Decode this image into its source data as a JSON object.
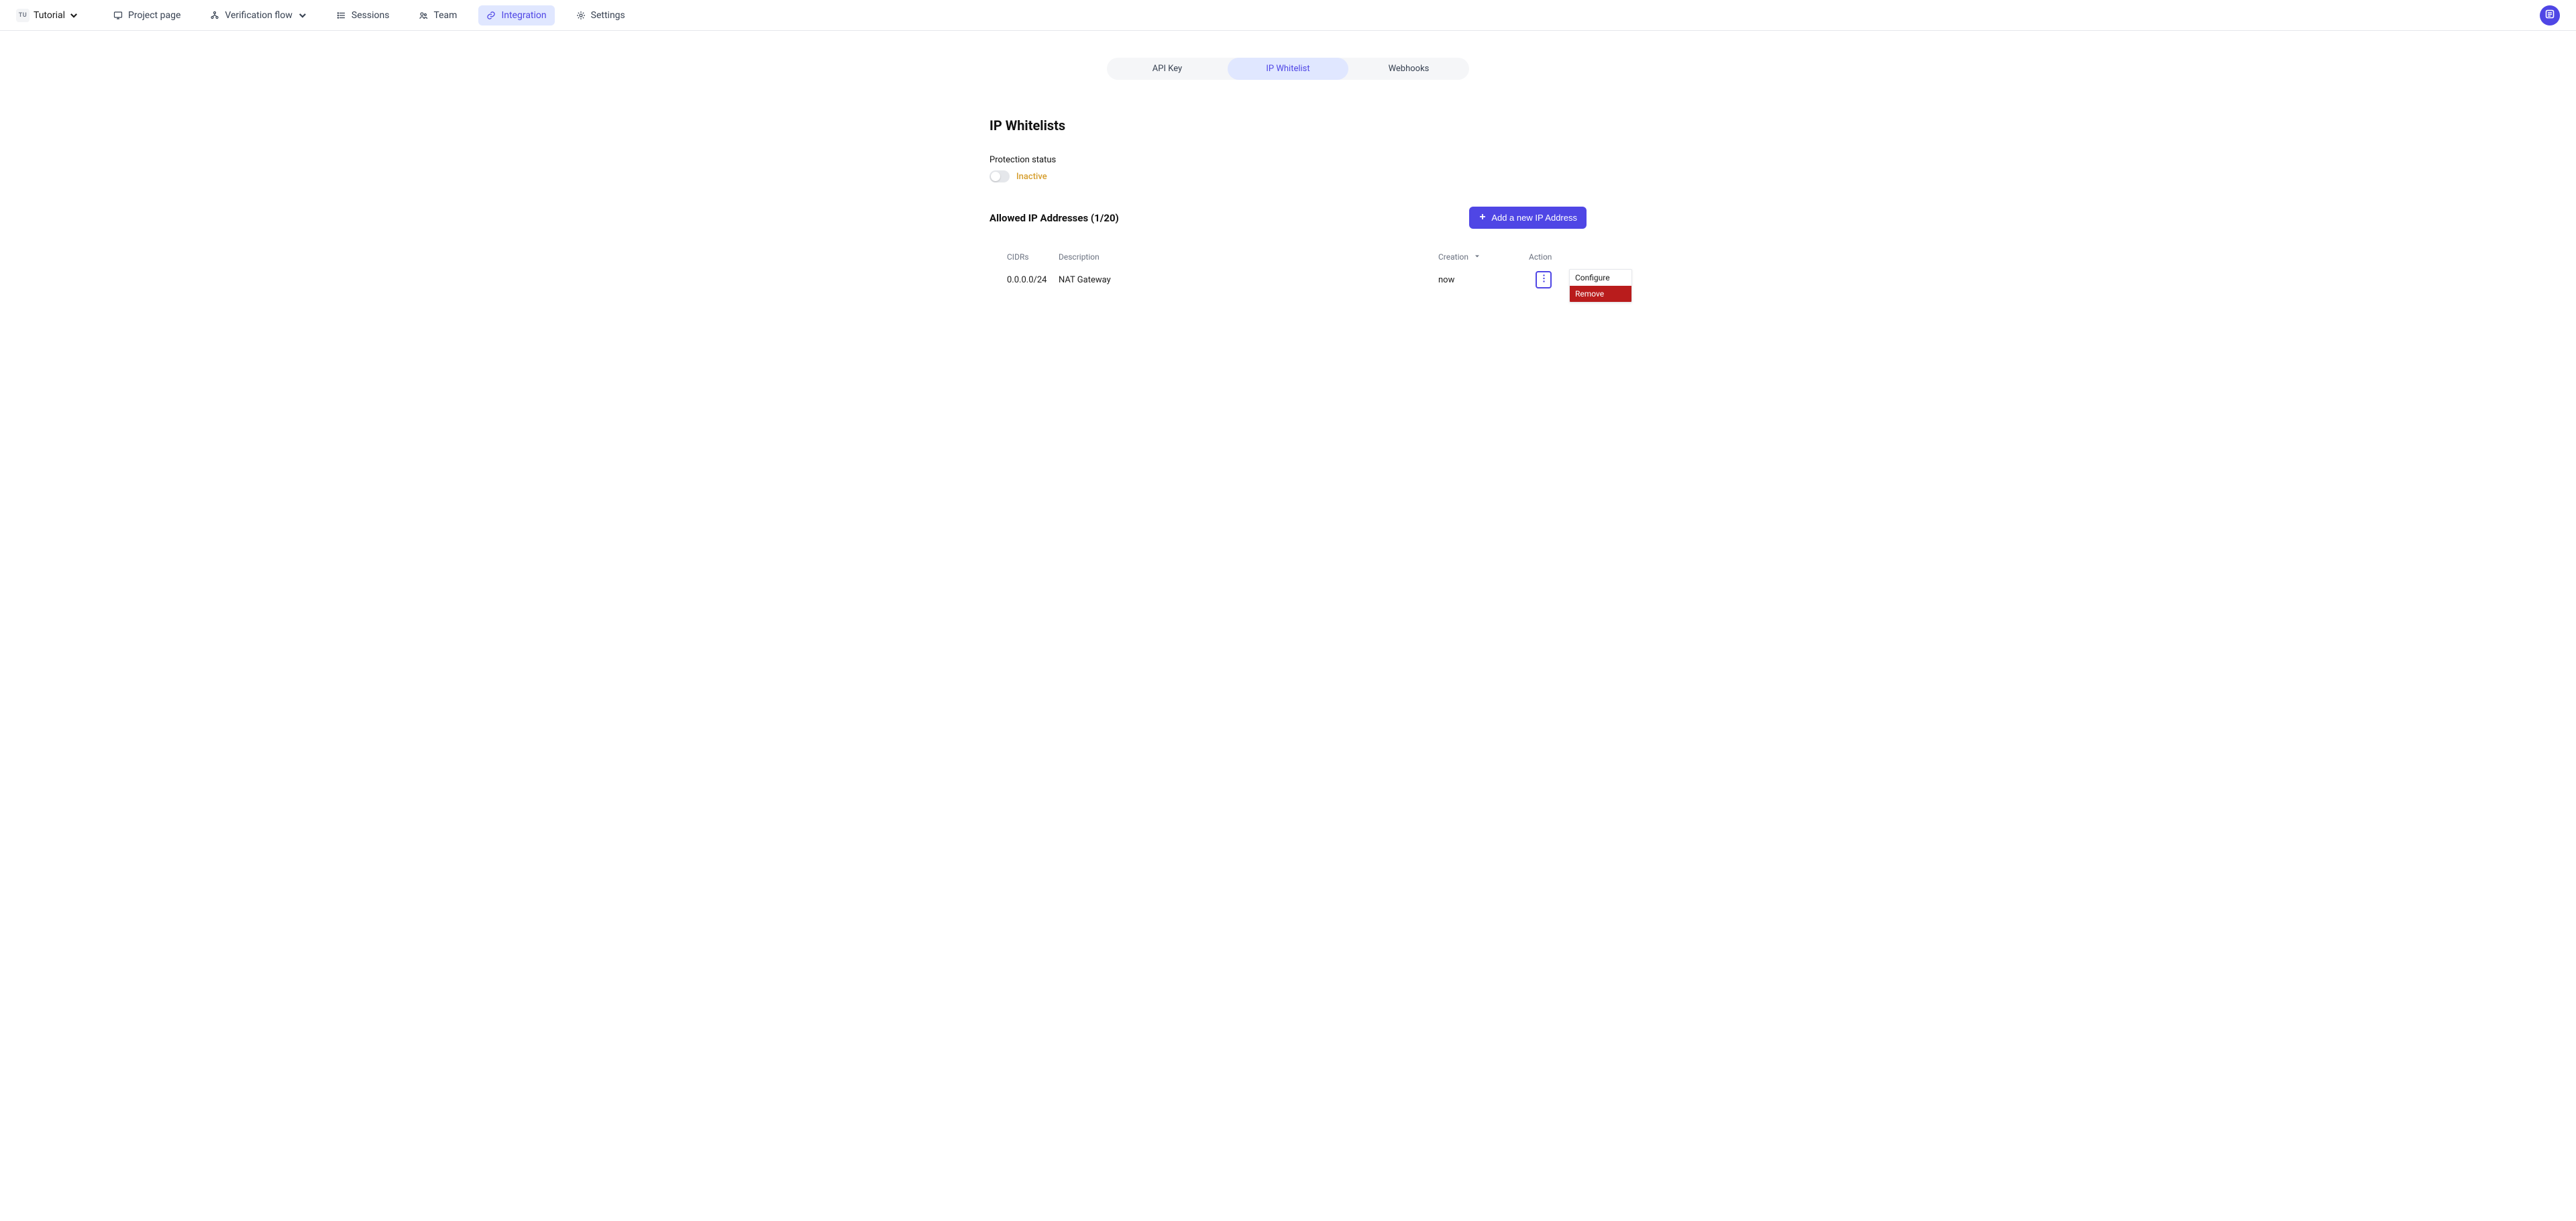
{
  "project": {
    "badge": "TU",
    "name": "Tutorial"
  },
  "nav": {
    "project_page": "Project page",
    "verification_flow": "Verification flow",
    "sessions": "Sessions",
    "team": "Team",
    "integration": "Integration",
    "settings": "Settings"
  },
  "tabs": {
    "api_key": "API Key",
    "ip_whitelist": "IP Whitelist",
    "webhooks": "Webhooks"
  },
  "page": {
    "title": "IP Whitelists",
    "protection_label": "Protection status",
    "protection_status": "Inactive",
    "allowed_title": "Allowed IP Addresses (1/20)",
    "add_button": "Add a new IP Address"
  },
  "table": {
    "headers": {
      "cidr": "CIDRs",
      "description": "Description",
      "creation": "Creation",
      "action": "Action"
    },
    "rows": [
      {
        "cidr": "0.0.0.0/24",
        "description": "NAT Gateway",
        "creation": "now"
      }
    ]
  },
  "menu": {
    "configure": "Configure",
    "remove": "Remove"
  }
}
